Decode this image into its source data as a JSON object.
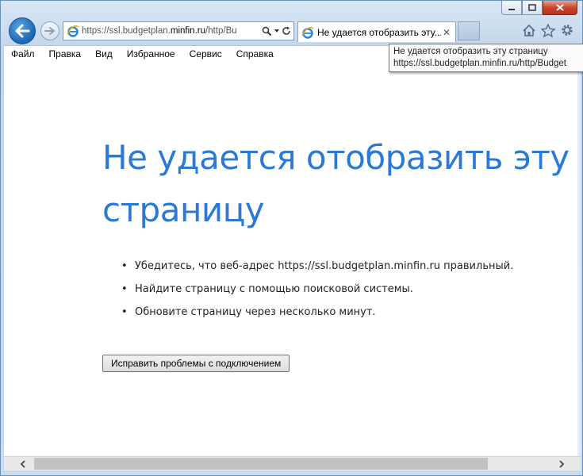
{
  "window": {
    "minimize_icon": "minimize-icon",
    "maximize_icon": "maximize-icon",
    "close_icon": "close-icon"
  },
  "address_bar": {
    "url_prefix": "https://ssl.budgetplan.",
    "url_domain": "minfin.ru",
    "url_suffix": "/http/Bu"
  },
  "tab": {
    "title": "Не удается отобразить эту...",
    "close_glyph": "✕"
  },
  "tooltip": {
    "line1": "Не удается отобразить эту страницу",
    "line2": "https://ssl.budgetplan.minfin.ru/http/Budget"
  },
  "menu": {
    "items": [
      "Файл",
      "Правка",
      "Вид",
      "Избранное",
      "Сервис",
      "Справка"
    ]
  },
  "page": {
    "heading": "Не удается отобразить эту страницу",
    "tips": [
      "Убедитесь, что веб-адрес https://ssl.budgetplan.minfin.ru правильный.",
      "Найдите страницу с помощью поисковой системы.",
      "Обновите страницу через несколько минут."
    ],
    "fix_button": "Исправить проблемы с подключением"
  },
  "colors": {
    "heading": "#2b79d4",
    "back_button": "#1a66b3",
    "close_button": "#c7482c"
  }
}
